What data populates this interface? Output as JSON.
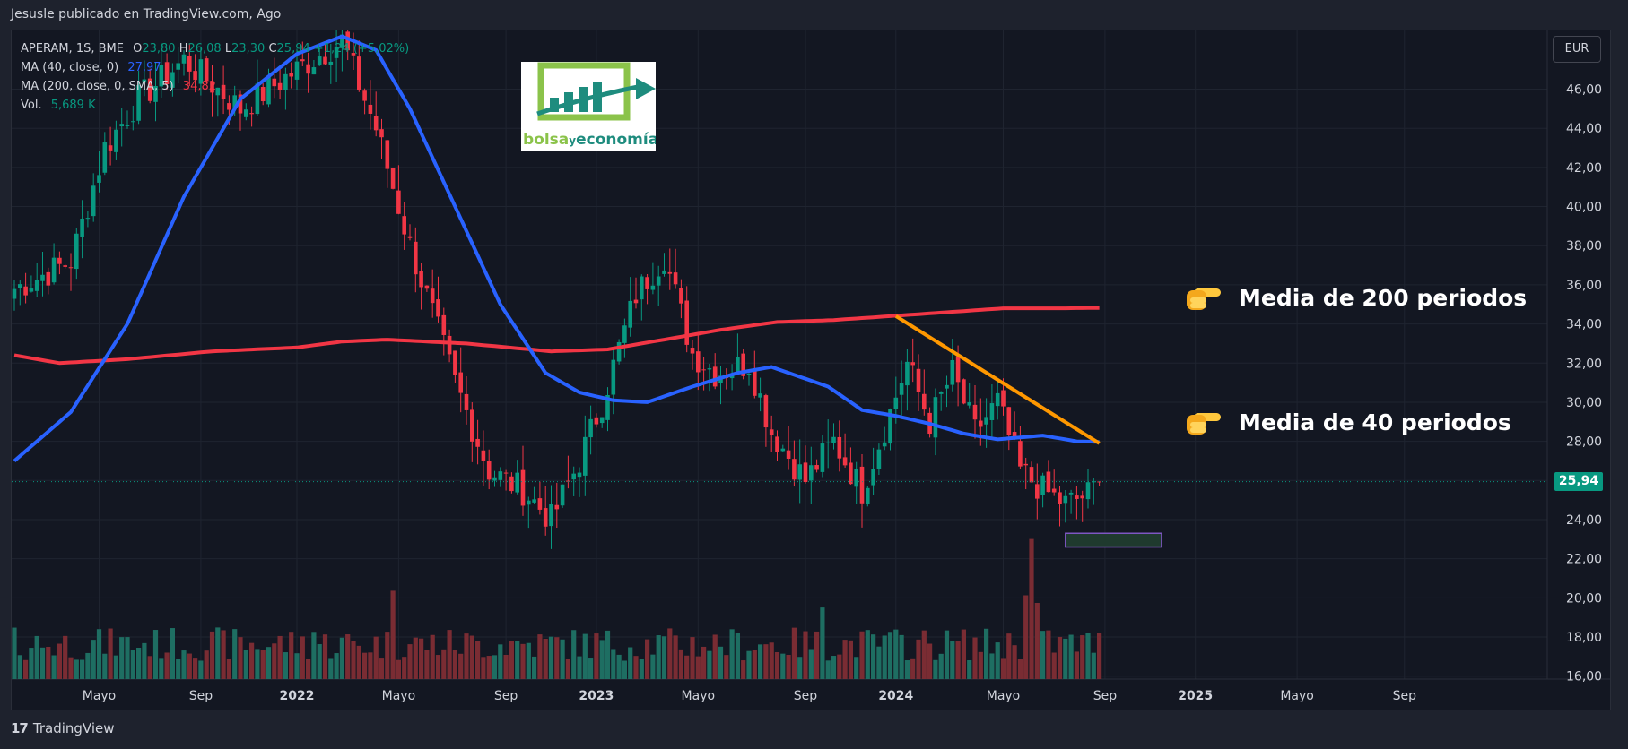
{
  "header": {
    "publisher": "Jesusle publicado en TradingView.com, Ago"
  },
  "legend": {
    "symbol_line": "APERAM, 1S, BME",
    "ohlc": {
      "o_label": "O",
      "o": "23,80",
      "h_label": "H",
      "h": "26,08",
      "l_label": "L",
      "l": "23,30",
      "c_label": "C",
      "c": "25,94",
      "change": "+1,24 (+5,02%)"
    },
    "ma40": {
      "label": "MA (40, close, 0)",
      "value": "27,97"
    },
    "ma200": {
      "label": "MA (200, close, 0, SMA, 5)",
      "value": "34,82"
    },
    "vol": {
      "label": "Vol.",
      "value": "5,689 K"
    }
  },
  "currency": "EUR",
  "last_price": "25,94",
  "footer": {
    "brand": "TradingView"
  },
  "logo": {
    "text_part1": "bolsa",
    "text_part2": "y",
    "text_part3": "economía"
  },
  "annotations": [
    {
      "text": "Media de 200 periodos"
    },
    {
      "text": "Media de 40 periodos"
    }
  ],
  "colors": {
    "up": "#089981",
    "down": "#f23645",
    "ma40": "#2962ff",
    "ma200": "#f23645",
    "trendline": "#ff9800",
    "vol_up": "#1e6e62",
    "vol_down": "#7a2c33",
    "background": "#131722"
  },
  "chart_data": {
    "type": "candlestick",
    "timeframe": "1S",
    "ylim": [
      14.2,
      49.0
    ],
    "y_ticks": [
      "46,00",
      "44,00",
      "42,00",
      "40,00",
      "38,00",
      "36,00",
      "34,00",
      "32,00",
      "30,00",
      "28,00",
      "26,00",
      "24,00",
      "22,00",
      "20,00",
      "18,00",
      "16,00"
    ],
    "x_ticks": [
      "Mayo",
      "Sep",
      "2022",
      "Mayo",
      "Sep",
      "2023",
      "Mayo",
      "Sep",
      "2024",
      "Mayo",
      "Sep",
      "2025",
      "Mayo",
      "Sep"
    ],
    "x_tick_bold": [
      false,
      false,
      true,
      false,
      false,
      true,
      false,
      false,
      true,
      false,
      false,
      true,
      false,
      false
    ],
    "x_tick_week": [
      15,
      33,
      50,
      68,
      87,
      103,
      121,
      140,
      156,
      175,
      193,
      209,
      227,
      246
    ],
    "bar_count": 193,
    "price_anchors": [
      [
        0,
        35.8
      ],
      [
        10,
        37.2
      ],
      [
        16,
        43.0
      ],
      [
        22,
        45.5
      ],
      [
        30,
        47.5
      ],
      [
        40,
        45.0
      ],
      [
        50,
        47.0
      ],
      [
        58,
        48.5
      ],
      [
        64,
        44.0
      ],
      [
        70,
        38.0
      ],
      [
        78,
        31.0
      ],
      [
        84,
        26.5
      ],
      [
        90,
        25.5
      ],
      [
        95,
        24.0
      ],
      [
        100,
        27.0
      ],
      [
        104,
        30.0
      ],
      [
        110,
        35.5
      ],
      [
        115,
        37.5
      ],
      [
        120,
        32.5
      ],
      [
        124,
        31.5
      ],
      [
        130,
        32.0
      ],
      [
        134,
        28.5
      ],
      [
        140,
        26.0
      ],
      [
        145,
        28.0
      ],
      [
        150,
        25.5
      ],
      [
        155,
        29.5
      ],
      [
        158,
        32.0
      ],
      [
        162,
        29.0
      ],
      [
        166,
        31.5
      ],
      [
        170,
        28.5
      ],
      [
        174,
        30.0
      ],
      [
        178,
        26.5
      ],
      [
        182,
        25.5
      ],
      [
        186,
        24.8
      ],
      [
        190,
        25.3
      ],
      [
        192,
        25.9
      ]
    ],
    "ma40_anchors": [
      [
        0,
        27.0
      ],
      [
        10,
        29.5
      ],
      [
        20,
        34.0
      ],
      [
        30,
        40.5
      ],
      [
        40,
        45.5
      ],
      [
        50,
        47.8
      ],
      [
        58,
        48.7
      ],
      [
        64,
        48.0
      ],
      [
        70,
        45.0
      ],
      [
        78,
        40.0
      ],
      [
        86,
        35.0
      ],
      [
        94,
        31.5
      ],
      [
        100,
        30.5
      ],
      [
        106,
        30.1
      ],
      [
        112,
        30.0
      ],
      [
        120,
        30.8
      ],
      [
        128,
        31.5
      ],
      [
        134,
        31.8
      ],
      [
        138,
        31.4
      ],
      [
        144,
        30.8
      ],
      [
        150,
        29.6
      ],
      [
        156,
        29.3
      ],
      [
        162,
        28.9
      ],
      [
        168,
        28.4
      ],
      [
        174,
        28.1
      ],
      [
        182,
        28.3
      ],
      [
        188,
        28.0
      ],
      [
        192,
        27.97
      ]
    ],
    "ma200_anchors": [
      [
        0,
        32.4
      ],
      [
        8,
        32.0
      ],
      [
        20,
        32.2
      ],
      [
        35,
        32.6
      ],
      [
        50,
        32.8
      ],
      [
        58,
        33.1
      ],
      [
        66,
        33.2
      ],
      [
        80,
        33.0
      ],
      [
        95,
        32.6
      ],
      [
        105,
        32.7
      ],
      [
        115,
        33.2
      ],
      [
        125,
        33.7
      ],
      [
        135,
        34.1
      ],
      [
        145,
        34.2
      ],
      [
        155,
        34.4
      ],
      [
        165,
        34.6
      ],
      [
        175,
        34.8
      ],
      [
        185,
        34.8
      ],
      [
        192,
        34.82
      ]
    ],
    "volume_max_k": 21000,
    "last_volume_k": 5.689,
    "trendline": {
      "start": {
        "week": 156,
        "price": 34.4
      },
      "end": {
        "week": 192,
        "price": 27.9
      }
    },
    "highlight_zone": {
      "week_from": 186,
      "week_to": 203,
      "price_from": 23.3,
      "price_to": 22.6
    }
  }
}
